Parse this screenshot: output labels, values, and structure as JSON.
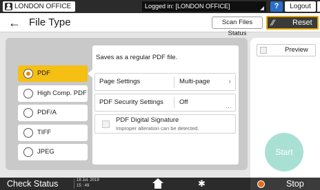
{
  "topbar": {
    "location": "LONDON OFFICE",
    "login_status": "Logged in: [LONDON OFFICE]",
    "help_label": "?",
    "logout_label": "Logout"
  },
  "header": {
    "back_icon": "back-arrow-icon",
    "title": "File Type",
    "scan_files_status_label": "Scan Files Status",
    "reset_label": "Reset"
  },
  "file_types": {
    "selected": "PDF",
    "options": [
      "PDF",
      "High Comp. PDF",
      "PDF/A",
      "TIFF",
      "JPEG"
    ]
  },
  "details": {
    "description": "Saves as a regular PDF file.",
    "page_settings_label": "Page Settings",
    "page_settings_value": "Multi-page",
    "security_label": "PDF Security Settings",
    "security_value": "Off",
    "signature_label": "PDF Digital Signature",
    "signature_sub": "Improper alteration can be detected."
  },
  "right_panel": {
    "preview_label": "Preview",
    "start_label": "Start"
  },
  "bottombar": {
    "check_status_label": "Check Status",
    "date": "18 Jul. 2019",
    "time": "15 : 49",
    "stop_label": "Stop"
  },
  "colors": {
    "selected_option": "#f5bf14",
    "reset_border": "#e8a700",
    "start_button": "#a9e0d4",
    "stop_icon": "#e86a1a",
    "help_button": "#2b6ec9"
  }
}
